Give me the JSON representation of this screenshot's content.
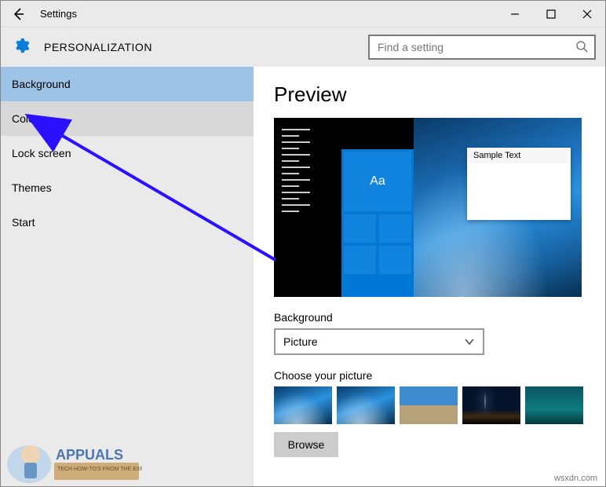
{
  "titlebar": {
    "title": "Settings"
  },
  "header": {
    "title": "PERSONALIZATION",
    "search_placeholder": "Find a setting"
  },
  "sidebar": {
    "items": [
      {
        "label": "Background",
        "state": "selected"
      },
      {
        "label": "Colors",
        "state": "hover"
      },
      {
        "label": "Lock screen",
        "state": ""
      },
      {
        "label": "Themes",
        "state": ""
      },
      {
        "label": "Start",
        "state": ""
      }
    ]
  },
  "content": {
    "preview_heading": "Preview",
    "sample_text": "Sample Text",
    "tile_aa": "Aa",
    "bg_label": "Background",
    "bg_value": "Picture",
    "choose_label": "Choose your picture",
    "browse_label": "Browse"
  },
  "credit": "wsxdn.com",
  "watermark": {
    "brand": "APPUALS",
    "tagline": "TECH HOW-TO'S FROM THE EXPERTS!"
  }
}
